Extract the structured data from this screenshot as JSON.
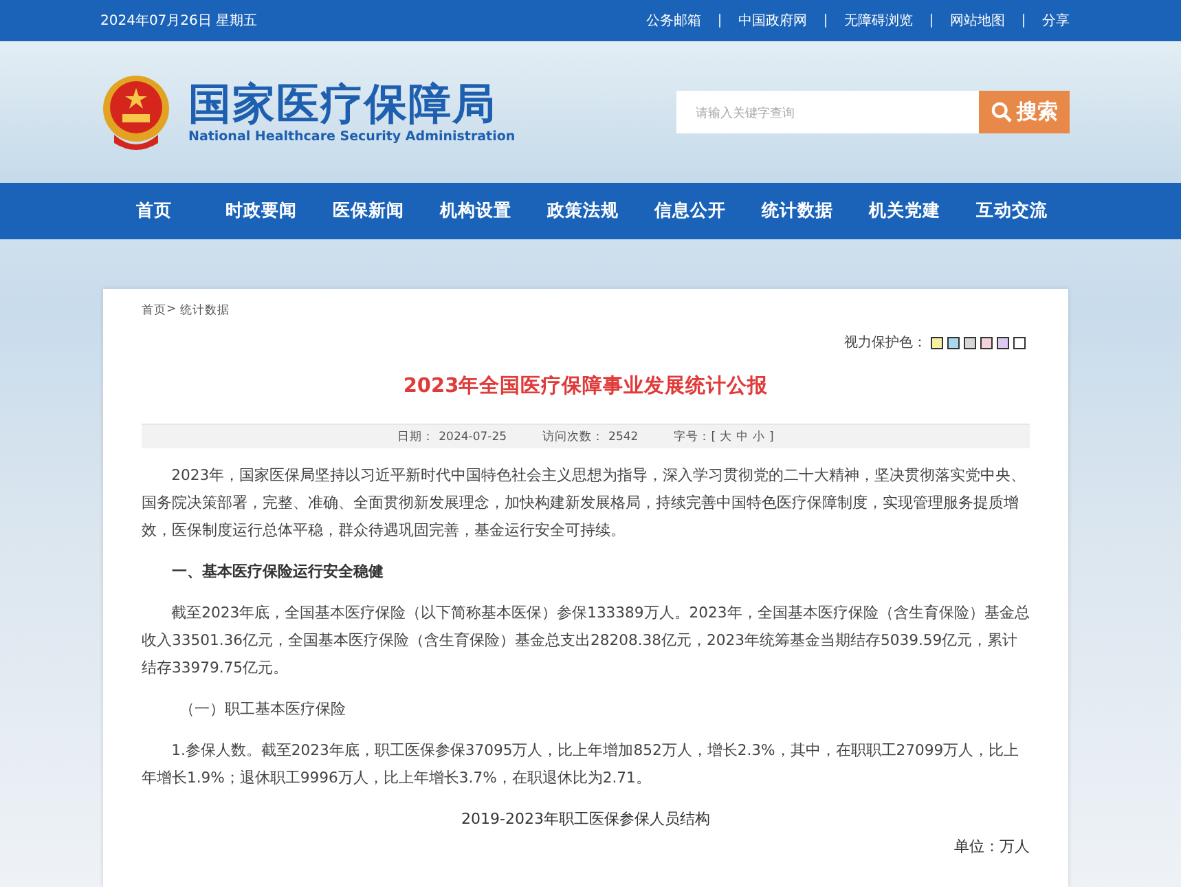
{
  "top_bar": {
    "date": "2024年07月26日 星期五",
    "links": [
      "公务邮箱",
      "中国政府网",
      "无障碍浏览",
      "网站地图",
      "分享"
    ]
  },
  "header": {
    "title": "国家医疗保障局",
    "subtitle": "National Healthcare Security Administration",
    "search": {
      "placeholder": "请输入关键字查询",
      "button": "搜索"
    }
  },
  "nav": [
    "首页",
    "时政要闻",
    "医保新闻",
    "机构设置",
    "政策法规",
    "信息公开",
    "统计数据",
    "机关党建",
    "互动交流"
  ],
  "breadcrumb": {
    "separator": ">",
    "items": [
      "首页",
      "统计数据"
    ]
  },
  "eye_care": {
    "label": "视力保护色：",
    "swatches": [
      {
        "color": "#f7efa2"
      },
      {
        "color": "#a9d7f0"
      },
      {
        "color": "#d6d6d6"
      },
      {
        "color": "#f5d3da"
      },
      {
        "color": "#dccaf0"
      },
      {
        "color": "#ffffff"
      }
    ]
  },
  "article": {
    "title": "2023年全国医疗保障事业发展统计公报",
    "meta": {
      "date_label": "日期：",
      "date": "2024-07-25",
      "visits_label": "访问次数：",
      "visits": "2542",
      "font_label": "字号：[",
      "font_sizes": [
        "大",
        "中",
        "小"
      ],
      "font_end": "]"
    },
    "blocks": [
      {
        "kind": "para",
        "text": "2023年，国家医保局坚持以习近平新时代中国特色社会主义思想为指导，深入学习贯彻党的二十大精神，坚决贯彻落实党中央、国务院决策部署，完整、准确、全面贯彻新发展理念，加快构建新发展格局，持续完善中国特色医疗保障制度，实现管理服务提质增效，医保制度运行总体平稳，群众待遇巩固完善，基金运行安全可持续。"
      },
      {
        "kind": "heading",
        "text": "一、基本医疗保险运行安全稳健"
      },
      {
        "kind": "para",
        "text": "截至2023年底，全国基本医疗保险（以下简称基本医保）参保133389万人。2023年，全国基本医疗保险（含生育保险）基金总收入33501.36亿元，全国基本医疗保险（含生育保险）基金总支出28208.38亿元，2023年统筹基金当期结存5039.59亿元，累计结存33979.75亿元。"
      },
      {
        "kind": "subheading",
        "text": "（一）职工基本医疗保险"
      },
      {
        "kind": "para",
        "text": "1.参保人数。截至2023年底，职工医保参保37095万人，比上年增加852万人，增长2.3%，其中，在职职工27099万人，比上年增长1.9%；退休职工9996万人，比上年增长3.7%，在职退休比为2.71。"
      },
      {
        "kind": "caption",
        "text": "2019-2023年职工医保参保人员结构"
      },
      {
        "kind": "unit",
        "text": "单位：万人"
      }
    ]
  }
}
